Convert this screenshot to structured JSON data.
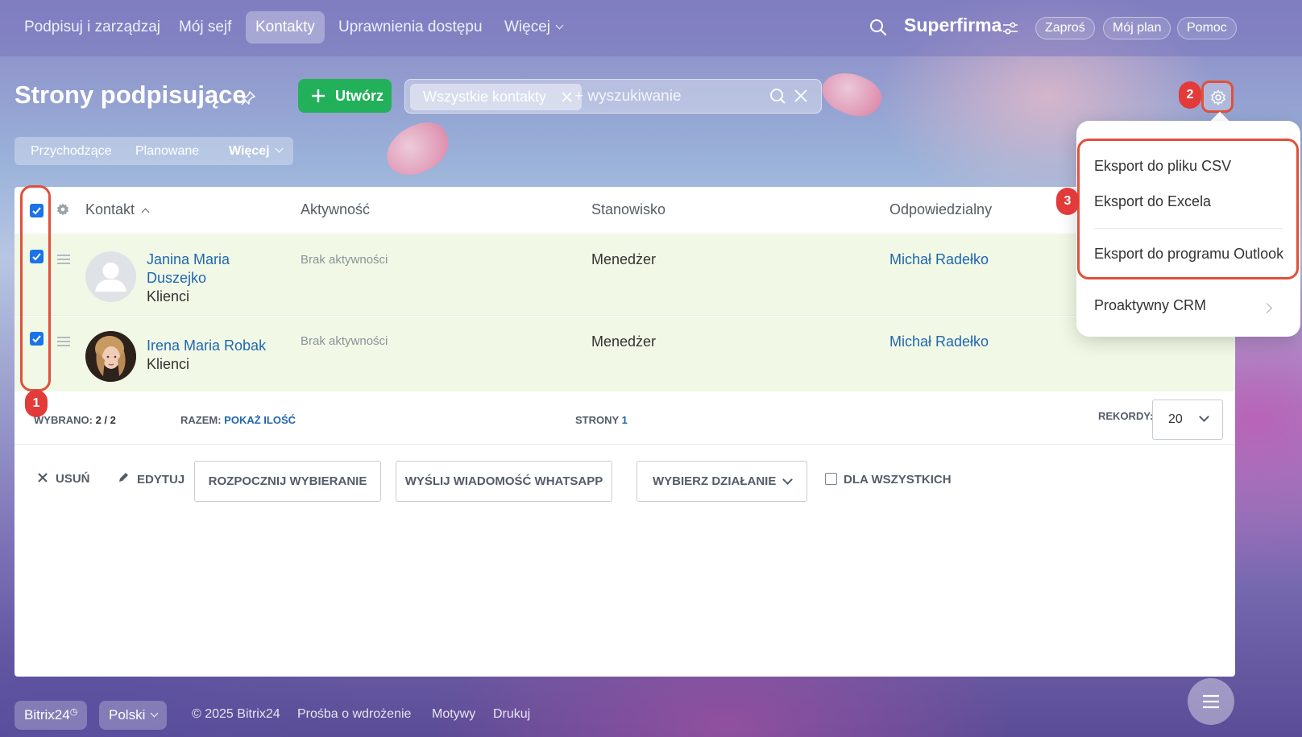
{
  "nav": {
    "items": [
      {
        "label": "Podpisuj i zarządzaj"
      },
      {
        "label": "Mój sejf"
      },
      {
        "label": "Kontakty"
      },
      {
        "label": "Uprawnienia dostępu"
      },
      {
        "label": "Więcej"
      }
    ],
    "brand": "Superfirma",
    "invite": "Zaproś",
    "my_plan": "Mój plan",
    "help": "Pomoc"
  },
  "page": {
    "title": "Strony podpisujące",
    "create_label": "Utwórz",
    "filter_chip": "Wszystkie kontakty",
    "search_placeholder": "+ wyszukiwanie",
    "subtabs": [
      "Przychodzące",
      "Planowane",
      "Więcej"
    ]
  },
  "badges": [
    "1",
    "2",
    "3"
  ],
  "table": {
    "columns": [
      "Kontakt",
      "Aktywność",
      "Stanowisko",
      "Odpowiedzialny"
    ],
    "rows": [
      {
        "name_line1": "Janina Maria",
        "name_line2": "Duszejko",
        "type": "Klienci",
        "activity": "Brak aktywności",
        "position": "Menedżer",
        "responsible": "Michał Radełko"
      },
      {
        "name_line1": "Irena Maria Robak",
        "name_line2": "",
        "type": "Klienci",
        "activity": "Brak aktywności",
        "position": "Menedżer",
        "responsible": "Michał Radełko"
      }
    ],
    "footer": {
      "selected_label": "WYBRANO:",
      "selected_value": "2 / 2",
      "total_label": "RAZEM:",
      "total_link": "POKAŻ ILOŚĆ",
      "pages_label": "STRONY",
      "pages_value": "1",
      "records_label": "REKORDY:",
      "records_value": "20"
    },
    "actions": {
      "delete": "USUŃ",
      "edit": "EDYTUJ",
      "start_dial": "ROZPOCZNIJ WYBIERANIE",
      "whatsapp": "WYŚLIJ WIADOMOŚĆ WHATSAPP",
      "choose_action": "WYBIERZ DZIAŁANIE",
      "for_all": "DLA WSZYSTKICH"
    }
  },
  "menu": {
    "items": [
      "Eksport do pliku CSV",
      "Eksport do Excela",
      "Eksport do programu Outlook",
      "Proaktywny CRM"
    ]
  },
  "footer": {
    "bitrix": "Bitrix24",
    "lang": "Polski",
    "copyright": "© 2025 Bitrix24",
    "links": [
      "Prośba o wdrożenie",
      "Motywy",
      "Drukuj"
    ]
  },
  "colors": {
    "accent": "#22b15a",
    "link": "#2067b0",
    "highlight": "#e0503a",
    "badge": "#e33a3a",
    "row_selected": "#f1f9e6"
  }
}
